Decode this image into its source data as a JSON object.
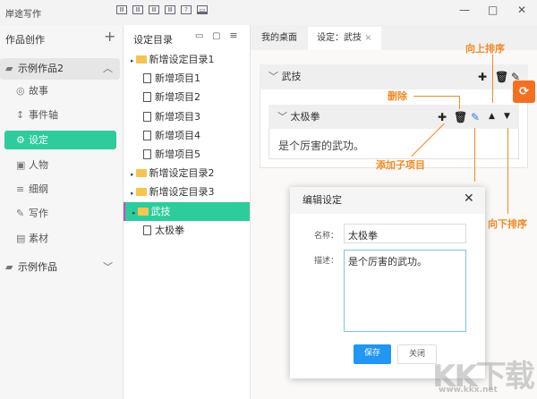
{
  "app": {
    "title": "岸途写作",
    "toolbar_icons": [
      "layout-1-icon",
      "layout-2-icon",
      "layout-3-icon",
      "layout-4-icon",
      "help-icon",
      "monitor-icon"
    ]
  },
  "sidebar": {
    "header": "作品创作",
    "add": "+",
    "works": [
      {
        "label": "示例作品2"
      },
      {
        "label": "示例作品"
      }
    ],
    "items": [
      {
        "label": "故事",
        "icon": "◎"
      },
      {
        "label": "事件轴",
        "icon": "↕"
      },
      {
        "label": "设定",
        "icon": "⚙"
      },
      {
        "label": "人物",
        "icon": "▣"
      },
      {
        "label": "细纲",
        "icon": "≡"
      },
      {
        "label": "写作",
        "icon": "✎"
      },
      {
        "label": "素材",
        "icon": "▤"
      }
    ]
  },
  "catalog": {
    "header": "设定目录",
    "rows": [
      {
        "label": "新增设定目录1",
        "type": "folder"
      },
      {
        "label": "新增项目1",
        "type": "doc"
      },
      {
        "label": "新增项目2",
        "type": "doc"
      },
      {
        "label": "新增项目3",
        "type": "doc"
      },
      {
        "label": "新增项目4",
        "type": "doc"
      },
      {
        "label": "新增项目5",
        "type": "doc"
      },
      {
        "label": "新增设定目录2",
        "type": "folder"
      },
      {
        "label": "新增设定目录3",
        "type": "folder"
      },
      {
        "label": "武技",
        "type": "folder"
      },
      {
        "label": "太极拳",
        "type": "doc"
      }
    ]
  },
  "tabs": [
    {
      "label": "我的桌面"
    },
    {
      "label": "设定：武技"
    }
  ],
  "panel": {
    "title": "武技",
    "card_title": "太极拳",
    "card_desc": "是个厉害的武功。"
  },
  "annotations": {
    "delete": "删除",
    "sort_up": "向上排序",
    "add_child": "添加子项目",
    "edit": "编辑",
    "sort_down": "向下排序"
  },
  "dialog": {
    "title": "编辑设定",
    "name_label": "名称：",
    "name_value": "太极拳",
    "desc_label": "描述：",
    "desc_value": "是个厉害的武功。",
    "save": "保存",
    "close": "关闭"
  },
  "watermark": {
    "logo": "KK下载",
    "url": "www.kkx.net"
  },
  "colors": {
    "accent": "#2ecc9c",
    "annotation": "#f08a24",
    "primary": "#2196f3"
  }
}
